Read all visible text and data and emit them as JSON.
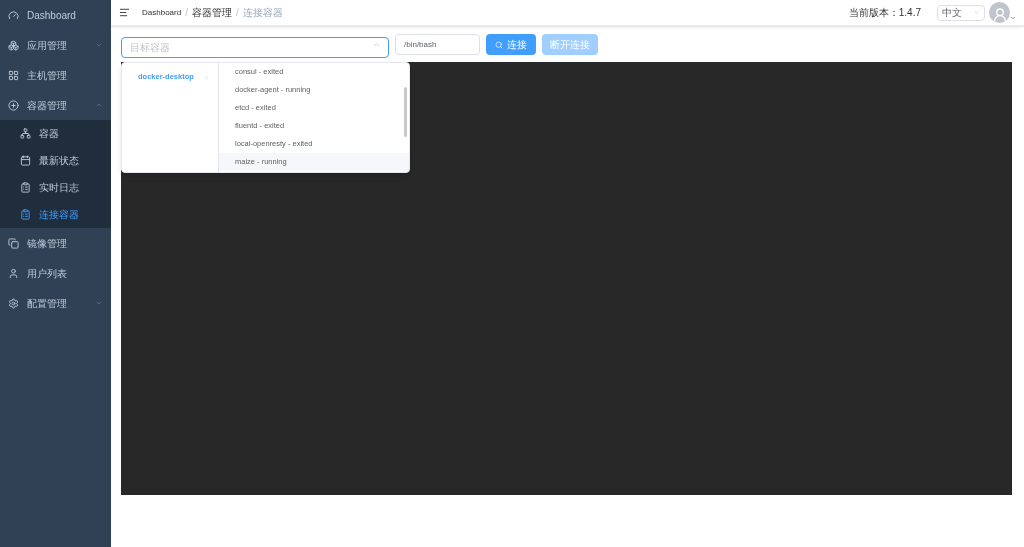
{
  "sidebar": {
    "items": [
      {
        "label": "Dashboard",
        "selected": false
      },
      {
        "label": "应用管理",
        "expanded": false,
        "selected": false
      },
      {
        "label": "主机管理",
        "selected": false
      },
      {
        "label": "容器管理",
        "expanded": true,
        "selected": false,
        "children": [
          {
            "label": "容器",
            "selected": false
          },
          {
            "label": "最新状态",
            "selected": false
          },
          {
            "label": "实时日志",
            "selected": false
          },
          {
            "label": "连接容器",
            "selected": true
          }
        ]
      },
      {
        "label": "镜像管理",
        "selected": false
      },
      {
        "label": "用户列表",
        "selected": false
      },
      {
        "label": "配置管理",
        "expanded": false,
        "selected": false
      }
    ]
  },
  "header": {
    "breadcrumb": [
      "Dashboard",
      "容器管理",
      "连接容器"
    ],
    "separator": "/",
    "version": "当前版本：1.4.7",
    "language": "中文"
  },
  "toolbar": {
    "target": {
      "placeholder": "目标容器",
      "expanded": true
    },
    "command": {
      "value": "/bin/bash"
    },
    "connect": {
      "label": "连接",
      "disabled": false
    },
    "disconnect": {
      "label": "断开连接",
      "disabled": true
    }
  },
  "cascader": {
    "hosts": [
      {
        "label": "docker-desktop",
        "selected": true
      }
    ],
    "containers": [
      {
        "label": "consul - exited",
        "hovered": false
      },
      {
        "label": "docker-agent - running",
        "hovered": false
      },
      {
        "label": "etcd - exited",
        "hovered": false
      },
      {
        "label": "fluentd - exited",
        "hovered": false
      },
      {
        "label": "local-openresty - exited",
        "hovered": false
      },
      {
        "label": "maize - running",
        "hovered": true
      }
    ]
  }
}
